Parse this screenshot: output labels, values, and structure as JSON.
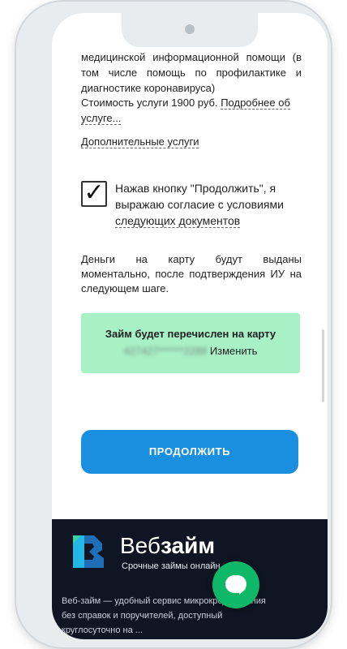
{
  "form": {
    "top_text": "медицинской информационной помощи (в том числе помощь по профилактике и диагностике коронавируса)",
    "cost_text": "Стоимость услуги 1900 руб.",
    "more_link": "Подробнее об услуге...",
    "extra_services": "Дополнительные услуги",
    "checkbox_mark": "✓",
    "consent_text": "Нажав кнопку \"Продолжить\", я выражаю согласие с условиями",
    "consent_link": "следующих документов",
    "money_note": "Деньги на карту будут выданы моментально, после подтверждения ИУ на следующем шаге."
  },
  "card": {
    "title": "Займ будет перечислен на карту",
    "masked_number": "427427******2288",
    "change_link": "Изменить"
  },
  "continue_button": "ПРОДОЛЖИТЬ",
  "footer": {
    "brand_prefix": "Веб",
    "brand_suffix": "займ",
    "tagline": "Срочные займы онлайн",
    "description": "Веб-займ — удобный сервис микрокредитования без справок и поручителей, доступный круглосуточно на ..."
  },
  "colors": {
    "accent": "#1a8fe0",
    "card_bg": "#a8f0c6",
    "footer_bg": "#0f1522",
    "chat": "#0fb868"
  },
  "icons": {
    "chat": "chat-bubble-icon",
    "check": "checkmark-icon"
  }
}
